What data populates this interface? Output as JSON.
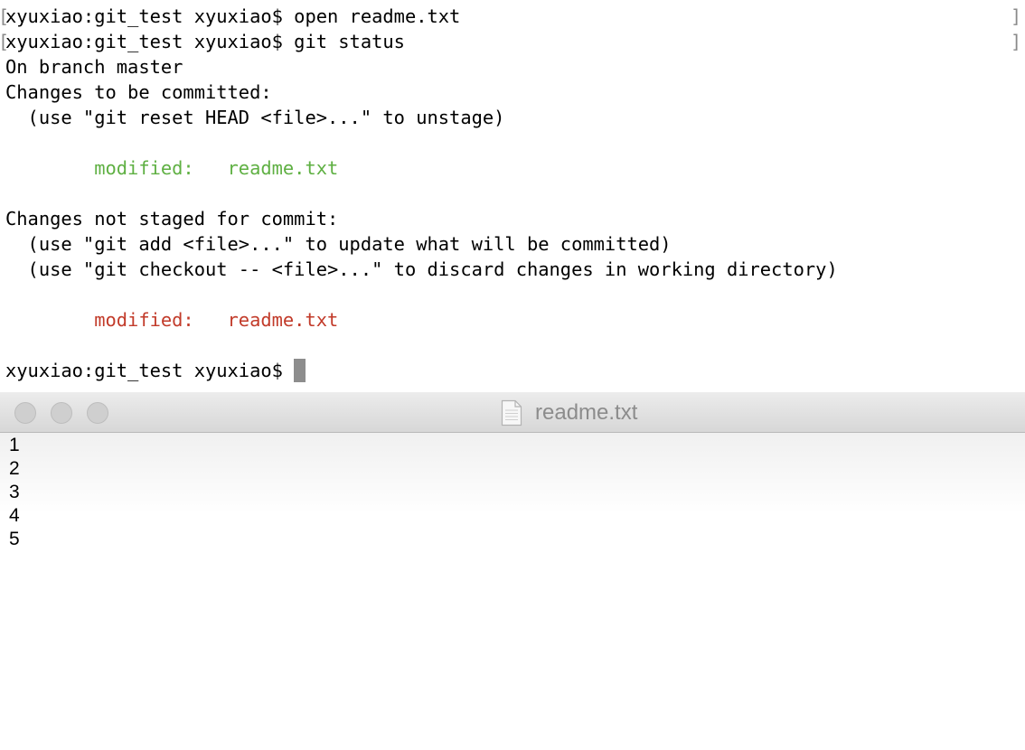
{
  "terminal": {
    "prompt": "xyuxiao:git_test xyuxiao$",
    "lines": {
      "cmd_open": "xyuxiao:git_test xyuxiao$ open readme.txt",
      "cmd_status": "xyuxiao:git_test xyuxiao$ git status",
      "branch": "On branch master",
      "staged_header": "Changes to be committed:",
      "staged_hint": "  (use \"git reset HEAD <file>...\" to unstage)",
      "staged_file": "        modified:   readme.txt",
      "unstaged_header": "Changes not staged for commit:",
      "unstaged_hint_1": "  (use \"git add <file>...\" to update what will be committed)",
      "unstaged_hint_2": "  (use \"git checkout -- <file>...\" to discard changes in working directory)",
      "unstaged_file": "        modified:   readme.txt",
      "prompt_current": "xyuxiao:git_test xyuxiao$ "
    },
    "marks": {
      "left": "[",
      "right": "]"
    },
    "colors": {
      "staged": "#5fb043",
      "unstaged": "#c23b2a",
      "cursor": "#8d8d8d"
    }
  },
  "editor": {
    "title": "readme.txt",
    "title_icon": "document-icon",
    "lines": [
      "1",
      "2",
      "3",
      "4",
      "5"
    ]
  }
}
